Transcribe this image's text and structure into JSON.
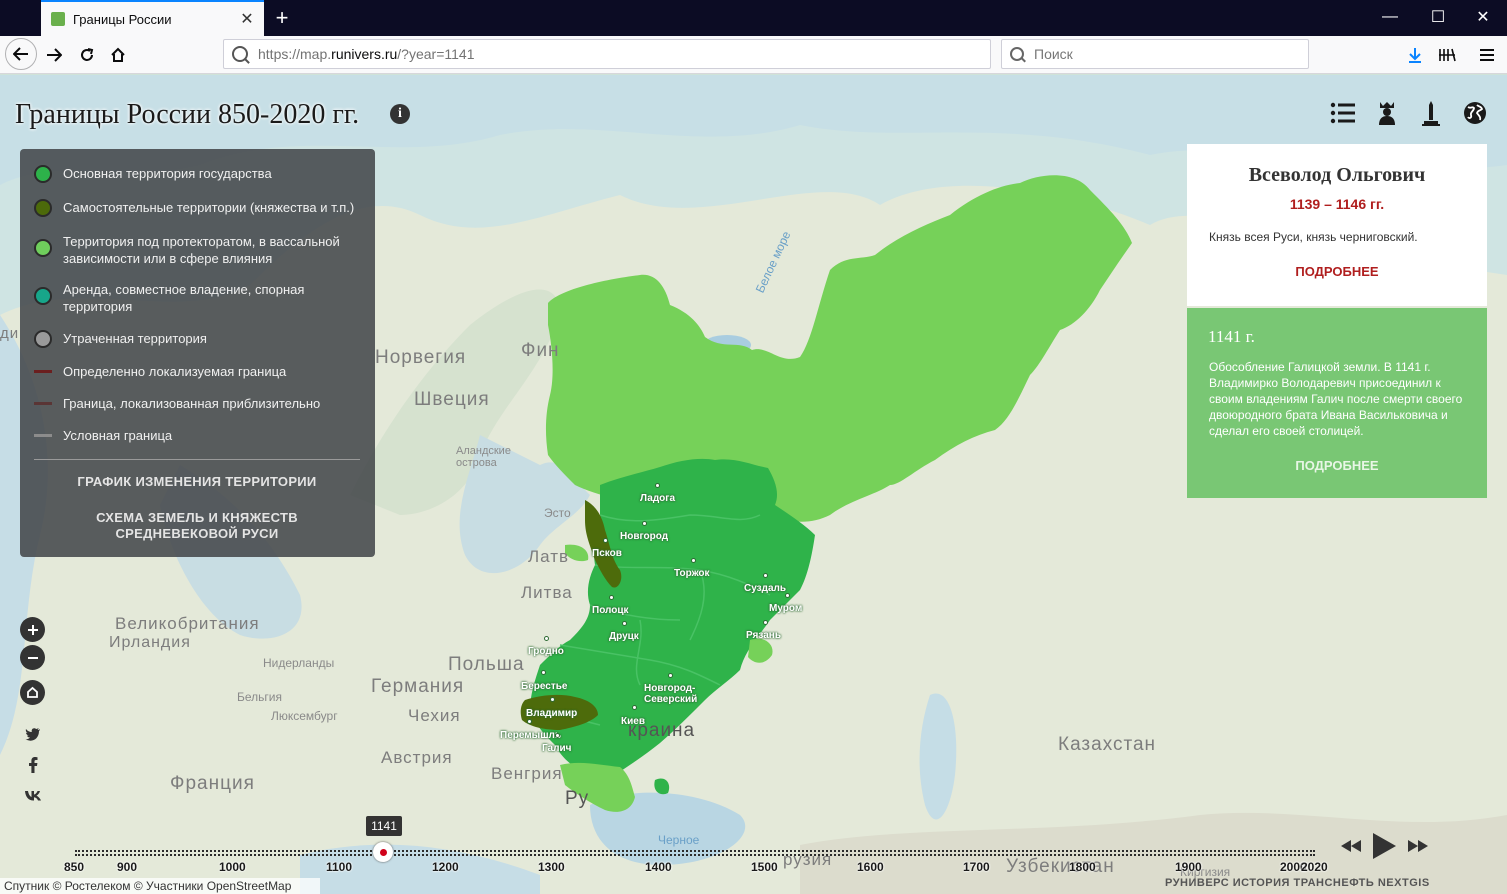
{
  "browser": {
    "tab_title": "Границы России",
    "url_prefix": "https://map.",
    "url_domain": "runivers.ru",
    "url_suffix": "/?year=1141",
    "search_placeholder": "Поиск"
  },
  "header": {
    "title": "Границы России 850-2020 гг.",
    "info_glyph": "i"
  },
  "legend": {
    "items": [
      {
        "label": "Основная территория государства",
        "color": "#2db24a"
      },
      {
        "label": "Самостоятельные территории (княжества и т.п.)",
        "color": "#4c6a0a"
      },
      {
        "label": "Территория под протекторатом, в вассальной зависимости или в сфере влияния",
        "color": "#6fce5c"
      },
      {
        "label": "Аренда, совместное владение, спорная территория",
        "color": "#17a68a"
      },
      {
        "label": "Утраченная территория",
        "color": "#9a9a9a"
      }
    ],
    "lines": [
      {
        "label": "Определенно локализуемая граница",
        "color": "#6b1f1f"
      },
      {
        "label": "Граница, локализованная приблизительно",
        "color": "#5a3535"
      },
      {
        "label": "Условная граница",
        "color": "#8c8c8c"
      }
    ],
    "link_chart": "ГРАФИК ИЗМЕНЕНИЯ ТЕРРИТОРИИ",
    "link_scheme": "СХЕМА ЗЕМЕЛЬ И КНЯЖЕСТВ СРЕДНЕВЕКОВОЙ РУСИ"
  },
  "ruler": {
    "name": "Всеволод Ольгович",
    "years": "1139 – 1146 гг.",
    "description": "Князь всея Руси, князь черниговский.",
    "more": "ПОДРОБНЕЕ"
  },
  "event": {
    "year": "1141 г.",
    "text": "Обособление Галицкой земли. В 1141 г. Владимирко Володаревич присоединил к своим владениям Галич после смерти своего двоюродного брата Ивана Васильковича и сделал его своей столицей.",
    "more": "ПОДРОБНЕЕ"
  },
  "map_labels": {
    "norway": "Норвегия",
    "sweden": "Швеция",
    "finland": "Фин",
    "latvia": "Латв",
    "lithuania": "Литва",
    "estonia": "Эсто",
    "uk": "Великобритания",
    "ireland": "Ирландия",
    "poland": "Польша",
    "germany": "Германия",
    "czech": "Чехия",
    "austria": "Австрия",
    "hungary": "Венгрия",
    "france": "Франция",
    "netherlands": "Нидерланды",
    "belgium": "Бельгия",
    "luxembourg": "Люксембург",
    "kazakhstan": "Казахстан",
    "uzbekistan": "Узбекистан",
    "kyrgyzstan": "Киргизия",
    "ukraine_part": "краина",
    "romania_part": "Ру",
    "georgia_part": "рузия",
    "white_sea": "Белое море",
    "black_sea": "Черное",
    "aland": "Аландские острова",
    "di": "ди"
  },
  "cities": [
    {
      "name": "Ладога"
    },
    {
      "name": "Новгород"
    },
    {
      "name": "Псков"
    },
    {
      "name": "Торжок"
    },
    {
      "name": "Суздаль"
    },
    {
      "name": "Муром"
    },
    {
      "name": "Полоцк"
    },
    {
      "name": "Друцк"
    },
    {
      "name": "Рязань"
    },
    {
      "name": "Гродно"
    },
    {
      "name": "Берестье"
    },
    {
      "name": "Новгород-Северский"
    },
    {
      "name": "Владимир"
    },
    {
      "name": "Киев"
    },
    {
      "name": "Перемышль"
    },
    {
      "name": "Галич"
    }
  ],
  "timeline": {
    "current_year": "1141",
    "start_year": 850,
    "end_year": 2020,
    "ticks": [
      "850",
      "900",
      "1000",
      "1100",
      "1200",
      "1300",
      "1400",
      "1500",
      "1600",
      "1700",
      "1800",
      "1900",
      "2000",
      "2020"
    ]
  },
  "attribution": "Спутник © Ростелеком © Участники OpenStreetMap",
  "partners": "РУНИВЕРС  ИСТОРИЯ  ТРАНСНЕФТЬ  NEXTGIS",
  "colors": {
    "main_territory": "#2db24a",
    "independent": "#4c6a0a",
    "protectorate": "#6fce5c",
    "accent_red": "#b01e1e",
    "event_bg": "#79c774"
  }
}
